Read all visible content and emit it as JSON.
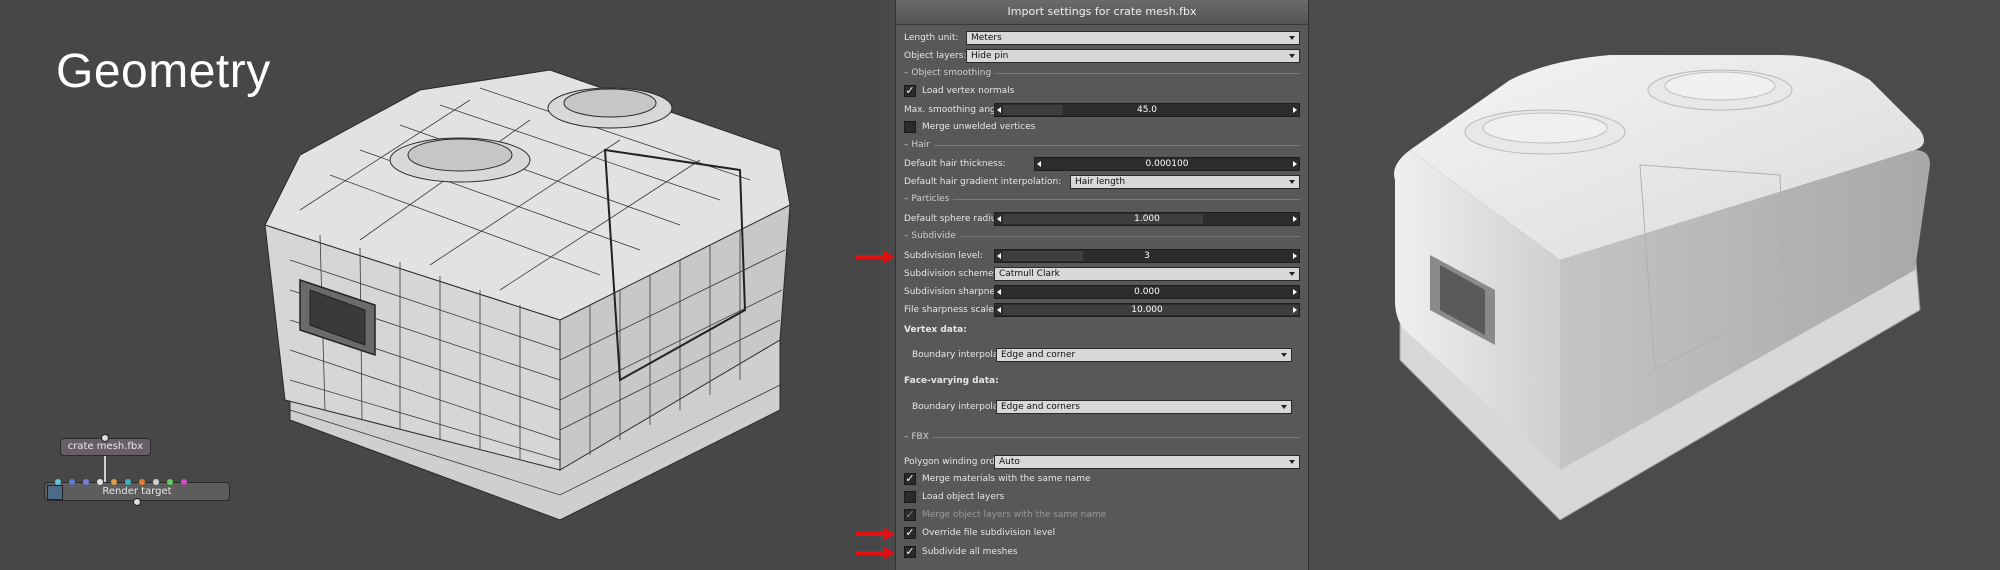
{
  "left": {
    "title": "Geometry",
    "nodes": {
      "file": "crate mesh.fbx",
      "render": "Render target"
    }
  },
  "dialog": {
    "title": "Import settings for crate mesh.fbx",
    "length_unit": {
      "label": "Length unit:",
      "value": "Meters"
    },
    "object_layers": {
      "label": "Object layers:",
      "value": "Hide pin"
    },
    "sec_smoothing": "Object smoothing",
    "load_vertex_normals": "Load vertex normals",
    "max_smoothing": {
      "label": "Max. smoothing angle:",
      "value": "45.0"
    },
    "merge_unwelded": "Merge unwelded vertices",
    "sec_hair": "Hair",
    "hair_thickness": {
      "label": "Default hair thickness:",
      "value": "0.000100"
    },
    "hair_gradient": {
      "label": "Default hair gradient interpolation:",
      "value": "Hair length"
    },
    "sec_particles": "Particles",
    "sphere_radius": {
      "label": "Default sphere radius:",
      "value": "1.000"
    },
    "sec_subdivide": "Subdivide",
    "subdiv_level": {
      "label": "Subdivision level:",
      "value": "3"
    },
    "subdiv_scheme": {
      "label": "Subdivision scheme:",
      "value": "Catmull Clark"
    },
    "subdiv_sharpness": {
      "label": "Subdivision sharpness:",
      "value": "0.000"
    },
    "file_sharpness": {
      "label": "File sharpness scale:",
      "value": "10.000"
    },
    "vertex_data": "Vertex data:",
    "vertex_boundary": {
      "label": "Boundary interpolation:",
      "value": "Edge and corner"
    },
    "face_data": "Face-varying data:",
    "face_boundary": {
      "label": "Boundary interpolation:",
      "value": "Edge and corners"
    },
    "sec_fbx": "FBX",
    "winding": {
      "label": "Polygon winding order:",
      "value": "Auto"
    },
    "merge_materials": "Merge materials with the same name",
    "load_object_layers": "Load object layers",
    "merge_object_layers": "Merge object layers with the same name",
    "override_subdiv": "Override file subdivision level",
    "subdivide_all": "Subdivide all meshes"
  },
  "colors": {
    "highlight_arrow": "#e01010"
  }
}
